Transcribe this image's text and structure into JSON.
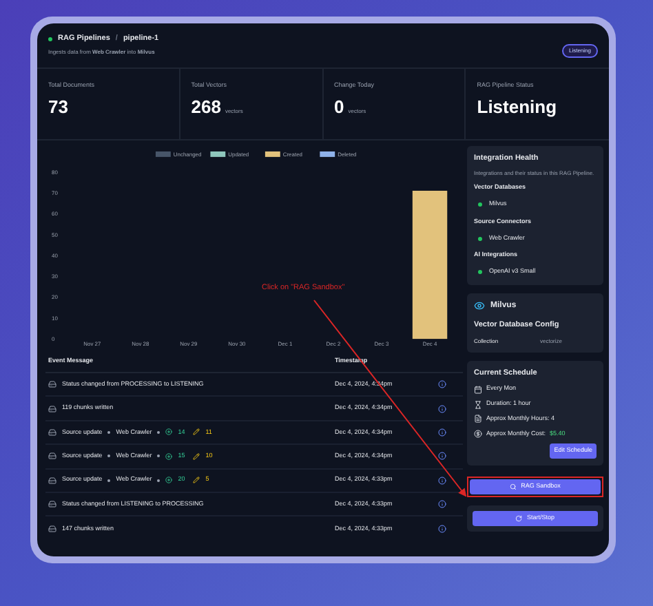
{
  "header": {
    "breadcrumb": "RAG Pipelines",
    "separator": "/",
    "pipeline": "pipeline-1",
    "subtitle": "Ingests data from **Web Crawler** into **Milvus**",
    "badge": "Listening",
    "healthy": true
  },
  "stats": [
    {
      "label": "Total Documents",
      "value": "73"
    },
    {
      "label": "Total Vectors",
      "value": "268",
      "unit": "vectors"
    },
    {
      "label": "Change Today",
      "value": "0",
      "unit": "vectors"
    },
    {
      "label": "RAG Pipeline Status",
      "value": "Listening"
    }
  ],
  "chart_data": {
    "type": "bar",
    "stacked": true,
    "categories": [
      "Nov 27",
      "Nov 28",
      "Nov 29",
      "Nov 30",
      "Dec 1",
      "Dec 2",
      "Dec 3",
      "Dec 4"
    ],
    "yticks": [
      0,
      10,
      20,
      30,
      40,
      50,
      60,
      70,
      80
    ],
    "ylim": [
      0,
      80
    ],
    "series": [
      {
        "name": "Unchanged",
        "color": "#475569",
        "values": [
          0,
          0,
          0,
          0,
          0,
          0,
          0,
          0
        ]
      },
      {
        "name": "Updated",
        "color": "#8fc7bd",
        "values": [
          0,
          0,
          0,
          0,
          0,
          0,
          0,
          0
        ]
      },
      {
        "name": "Created",
        "color": "#e2c27c",
        "values": [
          0,
          0,
          0,
          0,
          0,
          0,
          0,
          71
        ]
      },
      {
        "name": "Deleted",
        "color": "#8fb2ea",
        "values": [
          0,
          0,
          0,
          0,
          0,
          0,
          0,
          0
        ]
      }
    ]
  },
  "events": {
    "columns": [
      "Event Message",
      "Timestamp"
    ],
    "rows": [
      {
        "kind": "text",
        "message": "Status changed from PROCESSING to LISTENING",
        "timestamp": "Dec 4, 2024, 4:34pm"
      },
      {
        "kind": "text",
        "message": "119 chunks written",
        "timestamp": "Dec 4, 2024, 4:34pm"
      },
      {
        "kind": "source",
        "message": "Source update",
        "source": "Web Crawler",
        "added": "14",
        "updated": "11",
        "timestamp": "Dec 4, 2024, 4:34pm"
      },
      {
        "kind": "source",
        "message": "Source update",
        "source": "Web Crawler",
        "added": "15",
        "updated": "10",
        "timestamp": "Dec 4, 2024, 4:34pm"
      },
      {
        "kind": "source",
        "message": "Source update",
        "source": "Web Crawler",
        "added": "20",
        "updated": "5",
        "timestamp": "Dec 4, 2024, 4:33pm"
      },
      {
        "kind": "text",
        "message": "Status changed from LISTENING to PROCESSING",
        "timestamp": "Dec 4, 2024, 4:33pm"
      },
      {
        "kind": "text",
        "message": "147 chunks written",
        "timestamp": "Dec 4, 2024, 4:33pm"
      }
    ]
  },
  "integration_health": {
    "title": "Integration Health",
    "description": "Integrations and their status in this RAG Pipeline.",
    "groups": [
      {
        "title": "Vector Databases",
        "items": [
          {
            "name": "Milvus",
            "healthy": true
          }
        ]
      },
      {
        "title": "Source Connectors",
        "items": [
          {
            "name": "Web Crawler",
            "healthy": true
          }
        ]
      },
      {
        "title": "AI Integrations",
        "items": [
          {
            "name": "OpenAI v3 Small",
            "healthy": true
          }
        ]
      }
    ]
  },
  "vector_db": {
    "name": "Milvus",
    "title": "Vector Database Config",
    "fields": [
      {
        "label": "Collection",
        "value": "vectorize"
      }
    ]
  },
  "schedule": {
    "title": "Current Schedule",
    "items": [
      {
        "kind": "calendar",
        "text": "Every Mon"
      },
      {
        "kind": "duration",
        "text": "Duration: 1 hour"
      },
      {
        "kind": "hours",
        "text": "Approx Monthly Hours: 4"
      },
      {
        "kind": "cost",
        "text": "Approx Monthly Cost:",
        "value": "$5.40"
      }
    ],
    "button": "Edit Schedule"
  },
  "sandbox_button": "RAG Sandbox",
  "start_button": "Start/Stop",
  "annotation": {
    "text": "Click on \"RAG Sandbox\""
  }
}
